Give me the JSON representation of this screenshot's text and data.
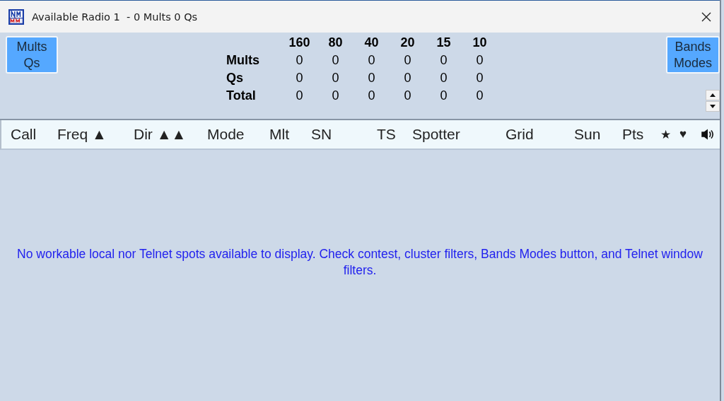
{
  "window": {
    "title": "Available Radio 1  - 0 Mults 0 Qs"
  },
  "left_button": {
    "lines": [
      "Mults",
      "Qs"
    ]
  },
  "right_button": {
    "lines": [
      "Bands",
      "Modes"
    ]
  },
  "stats": {
    "bands": [
      "160",
      "80",
      "40",
      "20",
      "15",
      "10"
    ],
    "rows": [
      {
        "label": "Mults",
        "values": [
          "0",
          "0",
          "0",
          "0",
          "0",
          "0"
        ]
      },
      {
        "label": "Qs",
        "values": [
          "0",
          "0",
          "0",
          "0",
          "0",
          "0"
        ]
      },
      {
        "label": "Total",
        "values": [
          "0",
          "0",
          "0",
          "0",
          "0",
          "0"
        ]
      }
    ]
  },
  "table": {
    "columns": [
      {
        "kind": "text",
        "label": "Call"
      },
      {
        "kind": "text",
        "label": "Freq ▲"
      },
      {
        "kind": "text",
        "label": "Dir ▲▲"
      },
      {
        "kind": "text",
        "label": "Mode"
      },
      {
        "kind": "text",
        "label": "Mlt"
      },
      {
        "kind": "text",
        "label": "SN"
      },
      {
        "kind": "text",
        "label": "TS"
      },
      {
        "kind": "text",
        "label": "Spotter"
      },
      {
        "kind": "text",
        "label": "Grid"
      },
      {
        "kind": "text",
        "label": "Sun"
      },
      {
        "kind": "text",
        "label": "Pts"
      },
      {
        "kind": "text",
        "label": "★"
      },
      {
        "kind": "text",
        "label": "♥"
      },
      {
        "kind": "speaker"
      }
    ],
    "message": "No workable local nor Telnet spots available to display. Check contest, cluster filters, Bands  Modes button, and Telnet window filters."
  }
}
